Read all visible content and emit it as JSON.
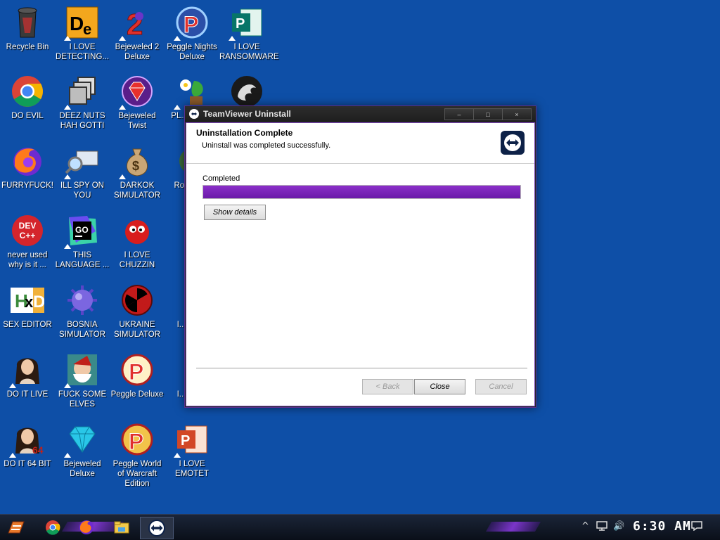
{
  "desktop": {
    "icons": [
      {
        "label": "Recycle Bin",
        "icon": "recycle-bin-icon"
      },
      {
        "label": "I LOVE DETECTING...",
        "icon": "detect-it-easy-icon"
      },
      {
        "label": "Bejeweled 2 Deluxe",
        "icon": "bejeweled-2-icon"
      },
      {
        "label": "Peggle Nights Deluxe",
        "icon": "peggle-nights-icon"
      },
      {
        "label": "I LOVE RANSOMWARE",
        "icon": "publisher-icon"
      },
      {
        "label": "DO EVIL",
        "icon": "chrome-icon"
      },
      {
        "label": "DEEZ NUTS HAH GOTTI",
        "icon": "copy-windows-icon"
      },
      {
        "label": "Bejeweled Twist",
        "icon": "bejeweled-twist-icon"
      },
      {
        "label": "PL... MET...",
        "icon": "plants-icon"
      },
      {
        "label": "",
        "icon": "dragon-icon"
      },
      {
        "label": "FURRYFUCK!",
        "icon": "firefox-icon"
      },
      {
        "label": "ILL SPY ON YOU",
        "icon": "spy-monitor-icon"
      },
      {
        "label": "DARKOK SIMULATOR",
        "icon": "money-bag-icon"
      },
      {
        "label": "Roc... D...",
        "icon": "partial-icon"
      },
      {
        "label": "never used why is it ...",
        "icon": "dev-cpp-icon"
      },
      {
        "label": "THIS LANGUAGE ...",
        "icon": "goland-icon"
      },
      {
        "label": "I LOVE CHUZZIN",
        "icon": "chuzzle-icon"
      },
      {
        "label": "SEX EDITOR",
        "icon": "hex-editor-icon"
      },
      {
        "label": "BOSNIA SIMULATOR",
        "icon": "spiked-ball-icon"
      },
      {
        "label": "UKRAINE SIMULATOR",
        "icon": "radiation-icon"
      },
      {
        "label": "I... MA...",
        "icon": "partial-icon"
      },
      {
        "label": "DO IT LIVE",
        "icon": "portrait-icon"
      },
      {
        "label": "FUCK SOME ELVES",
        "icon": "santa-icon"
      },
      {
        "label": "Peggle Deluxe",
        "icon": "peggle-icon"
      },
      {
        "label": "I... MA...",
        "icon": "partial-icon"
      },
      {
        "label": "DO IT 64 BIT",
        "icon": "portrait-64-icon"
      },
      {
        "label": "Bejeweled Deluxe",
        "icon": "diamond-icon"
      },
      {
        "label": "Peggle World of Warcraft Edition",
        "icon": "peggle-wow-icon"
      },
      {
        "label": "I LOVE EMOTET",
        "icon": "powerpoint-icon"
      }
    ]
  },
  "window": {
    "title": "TeamViewer Uninstall",
    "header_title": "Uninstallation Complete",
    "header_subtitle": "Uninstall was completed successfully.",
    "status": "Completed",
    "progress_percent": 100,
    "show_details": "Show details",
    "back": "< Back",
    "close": "Close",
    "cancel": "Cancel",
    "min_glyph": "–",
    "max_glyph": "□",
    "close_glyph": "×"
  },
  "taskbar": {
    "clock": "6:30 AM",
    "start_icon": "start-logo-icon",
    "pinned": [
      "chrome-icon",
      "firefox-icon",
      "file-explorer-icon"
    ],
    "active_app": "teamviewer-icon",
    "tray": [
      "up-arrow-icon",
      "network-icon",
      "volume-icon",
      "notifications-icon"
    ],
    "tray_glyphs": {
      "up": "^",
      "volume": "🔊"
    }
  },
  "colors": {
    "desktop": "#0e4fa7",
    "progress": "#7a28b8",
    "taskbar": "#121a2a",
    "accent": "#7a35c8"
  }
}
